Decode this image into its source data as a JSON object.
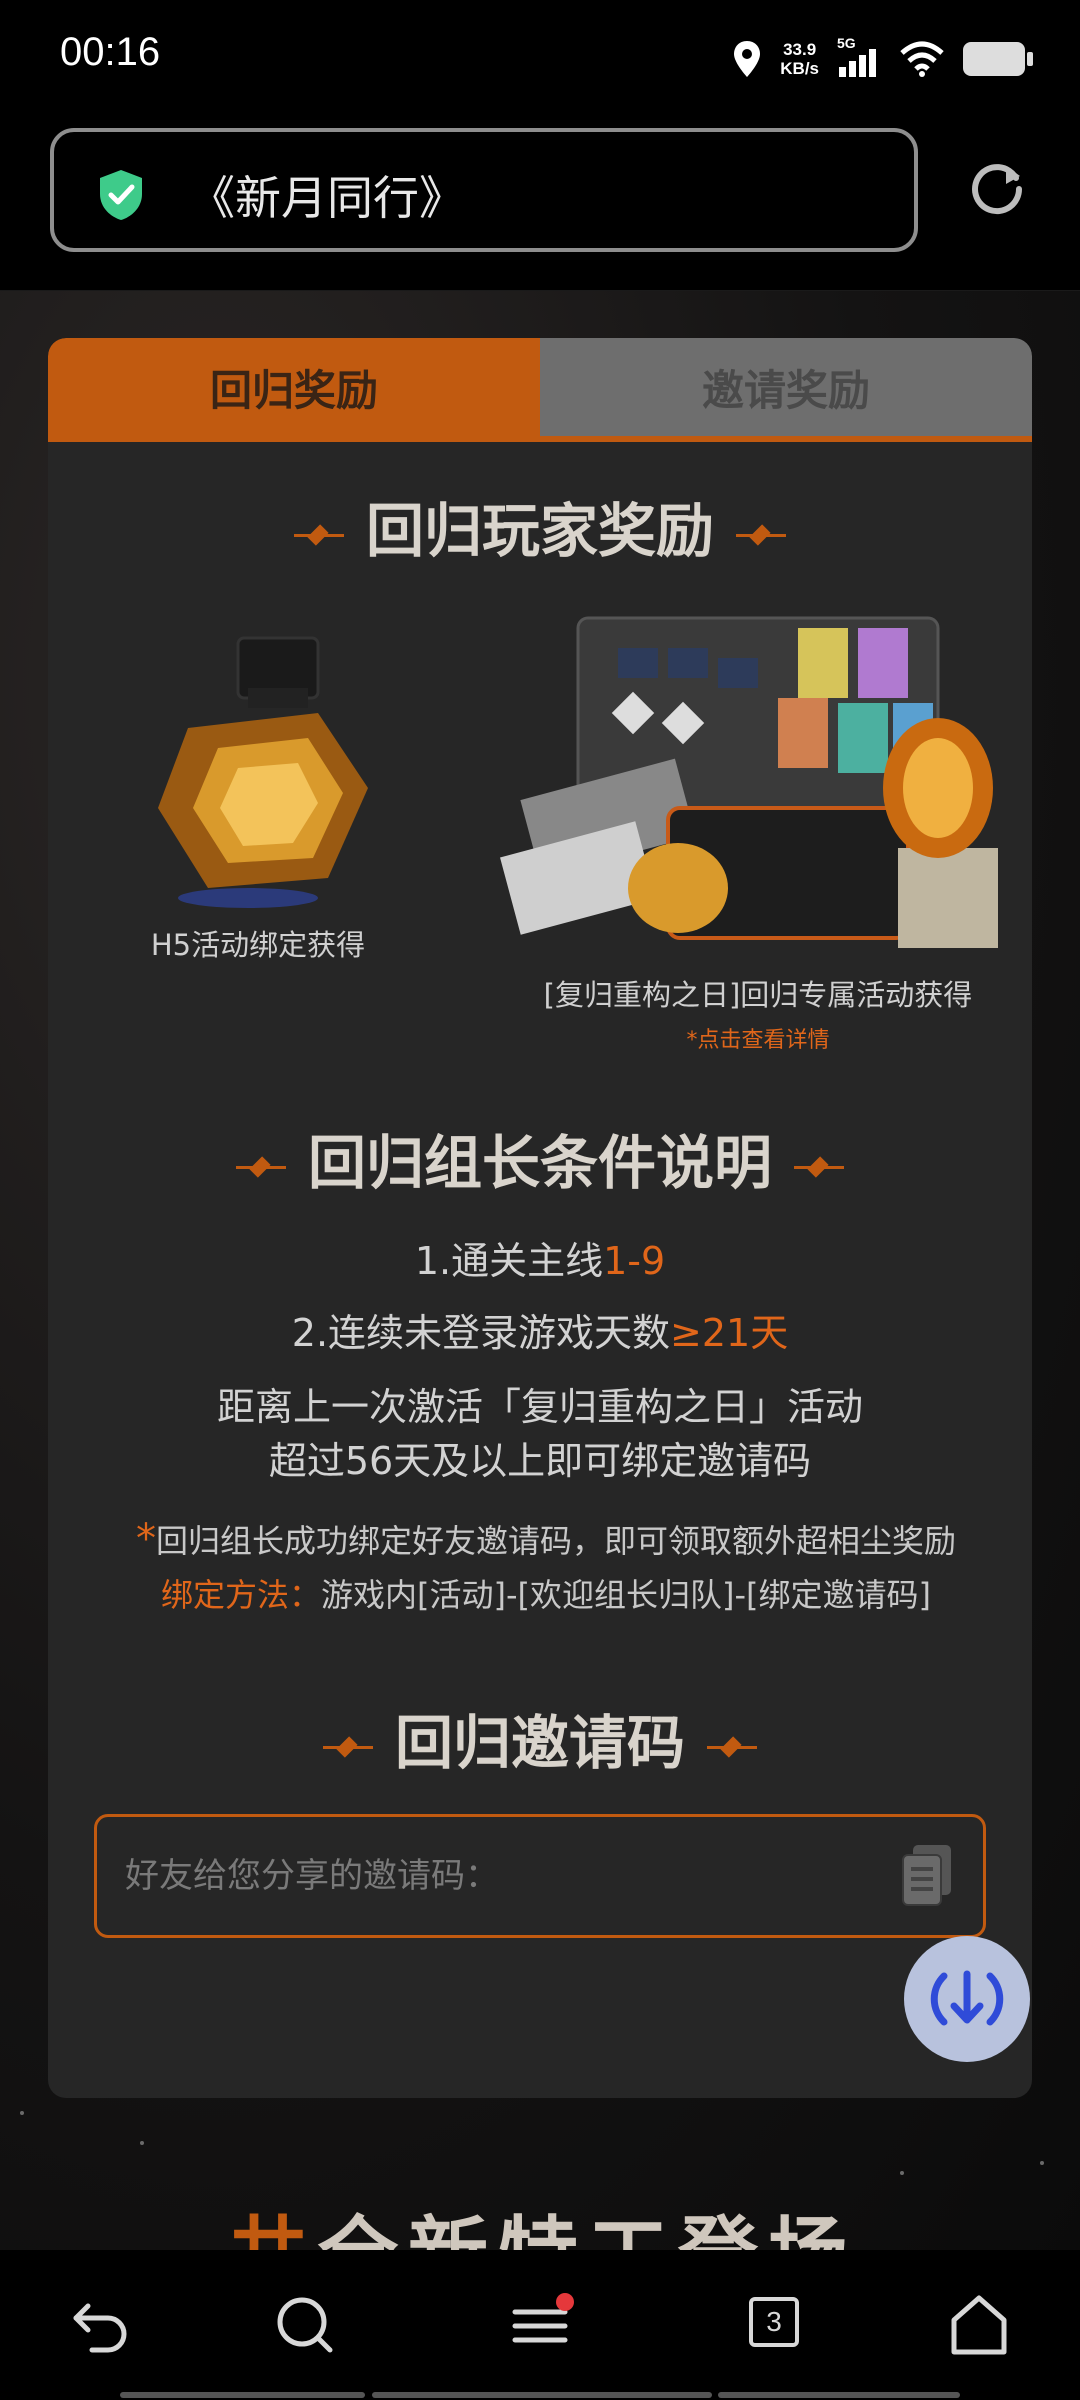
{
  "status_bar": {
    "time": "00:16",
    "net_speed_value": "33.9",
    "net_speed_unit": "KB/s",
    "signal_label": "5G",
    "icons": [
      "location-icon",
      "signal-icon",
      "wifi-icon",
      "battery-icon"
    ]
  },
  "browser": {
    "url_title": "《新月同行》",
    "security_icon": "shield-check-icon",
    "reload_icon": "reload-icon"
  },
  "tabs": [
    {
      "label": "回归奖励",
      "active": true
    },
    {
      "label": "邀请奖励",
      "active": false
    }
  ],
  "rewards": {
    "title": "回归玩家奖励",
    "items": [
      {
        "caption": "H5活动绑定获得"
      },
      {
        "caption": "[复归重构之日]回归专属活动获得",
        "detail_link": "*点击查看详情"
      }
    ]
  },
  "conditions": {
    "title": "回归组长条件说明",
    "line1_prefix": "1.通关主线",
    "line1_value": "1-9",
    "line2_prefix": "2.连续未登录游戏天数",
    "line2_value": "≥21天",
    "line3": "距离上一次激活「复归重构之日」活动",
    "line4": "超过56天及以上即可绑定邀请码",
    "note_star": "*",
    "note": "回归组长成功绑定好友邀请码，即可领取额外超相尘奖励",
    "method_label": "绑定方法：",
    "method": "游戏内[活动]-[欢迎组长归队]-[绑定邀请码]"
  },
  "invite": {
    "title": "回归邀请码",
    "placeholder": "好友给您分享的邀请码：",
    "copy_icon": "copy-icon",
    "download_icon": "download-icon"
  },
  "next_section": {
    "title_accent": "井",
    "title_rest": "全新特工登场"
  },
  "nav": {
    "tab_count": "3",
    "icons": [
      "back-icon",
      "search-icon",
      "menu-icon",
      "tabs-icon",
      "home-icon"
    ]
  },
  "colors": {
    "accent": "#c15a10",
    "highlight": "#e0661a",
    "shield": "#3ecb8a",
    "notification_dot": "#e5383b"
  }
}
